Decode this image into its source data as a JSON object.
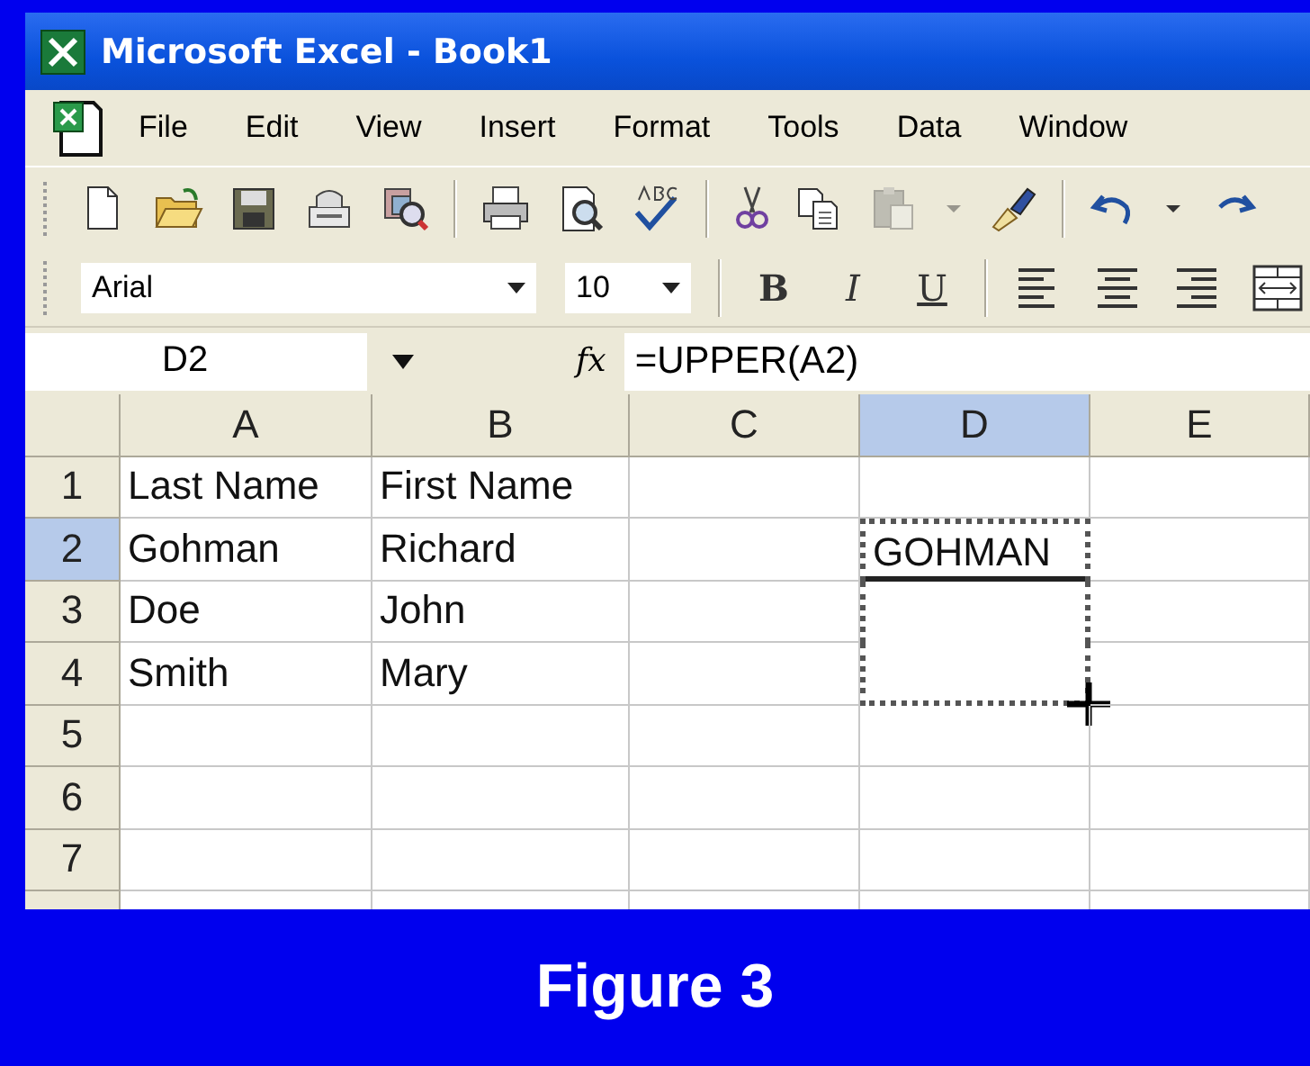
{
  "window": {
    "title": "Microsoft Excel - Book1"
  },
  "menu": [
    "File",
    "Edit",
    "View",
    "Insert",
    "Format",
    "Tools",
    "Data",
    "Window"
  ],
  "standard_toolbar": [
    {
      "kind": "new",
      "disabled": false
    },
    {
      "kind": "open",
      "disabled": false
    },
    {
      "kind": "save",
      "disabled": false
    },
    {
      "kind": "permission",
      "disabled": false
    },
    {
      "kind": "research",
      "disabled": false
    },
    {
      "kind": "separator",
      "disabled": false
    },
    {
      "kind": "print",
      "disabled": false
    },
    {
      "kind": "preview",
      "disabled": false
    },
    {
      "kind": "spelling",
      "disabled": false
    },
    {
      "kind": "separator",
      "disabled": false
    },
    {
      "kind": "cut",
      "disabled": false
    },
    {
      "kind": "copy",
      "disabled": false
    },
    {
      "kind": "paste",
      "disabled": true
    },
    {
      "kind": "dropdown",
      "disabled": true
    },
    {
      "kind": "brush",
      "disabled": false
    },
    {
      "kind": "separator",
      "disabled": false
    },
    {
      "kind": "undo",
      "disabled": false
    },
    {
      "kind": "dropdown",
      "disabled": false
    },
    {
      "kind": "redo",
      "disabled": false
    }
  ],
  "formatting_toolbar": {
    "font": "Arial",
    "size": "10",
    "styles": [
      {
        "kind": "bold",
        "label": "B"
      },
      {
        "kind": "italic",
        "label": "I"
      },
      {
        "kind": "underline",
        "label": "U"
      }
    ],
    "alignments": [
      {
        "kind": "left"
      },
      {
        "kind": "center"
      },
      {
        "kind": "right"
      },
      {
        "kind": "merge"
      }
    ]
  },
  "formula_bar": {
    "name_box": "D2",
    "function_label": "fx",
    "formula": "=UPPER(A2)"
  },
  "sheet": {
    "columns": [
      {
        "label": "A",
        "selected": false
      },
      {
        "label": "B",
        "selected": false
      },
      {
        "label": "C",
        "selected": false
      },
      {
        "label": "D",
        "selected": true
      },
      {
        "label": "E",
        "selected": false
      }
    ],
    "rows": [
      {
        "label": "1",
        "selected": false,
        "cells": [
          {
            "text": "Last Name",
            "selected": false,
            "marquee": false
          },
          {
            "text": "First Name",
            "selected": false,
            "marquee": false
          },
          {
            "selected": false,
            "marquee": false
          },
          {
            "selected": false,
            "marquee": false
          },
          {
            "selected": false,
            "marquee": false
          }
        ]
      },
      {
        "label": "2",
        "selected": true,
        "cells": [
          {
            "text": "Gohman",
            "selected": false,
            "marquee": false
          },
          {
            "text": "Richard",
            "selected": false,
            "marquee": false
          },
          {
            "selected": false,
            "marquee": false
          },
          {
            "text": "GOHMAN",
            "selected": true,
            "marquee": true
          },
          {
            "selected": false,
            "marquee": false
          }
        ]
      },
      {
        "label": "3",
        "selected": false,
        "cells": [
          {
            "text": "Doe",
            "selected": false,
            "marquee": false
          },
          {
            "text": "John",
            "selected": false,
            "marquee": false
          },
          {
            "selected": false,
            "marquee": false
          },
          {
            "selected": false,
            "marquee": true
          },
          {
            "selected": false,
            "marquee": false
          }
        ]
      },
      {
        "label": "4",
        "selected": false,
        "cells": [
          {
            "text": "Smith",
            "selected": false,
            "marquee": false
          },
          {
            "text": "Mary",
            "selected": false,
            "marquee": false
          },
          {
            "selected": false,
            "marquee": false
          },
          {
            "selected": false,
            "marquee": true
          },
          {
            "selected": false,
            "marquee": false
          }
        ]
      },
      {
        "label": "5",
        "selected": false,
        "cells": [
          {
            "selected": false,
            "marquee": false
          },
          {
            "selected": false,
            "marquee": false
          },
          {
            "selected": false,
            "marquee": false
          },
          {
            "selected": false,
            "marquee": false
          },
          {
            "selected": false,
            "marquee": false
          }
        ]
      },
      {
        "label": "6",
        "selected": false,
        "cells": [
          {
            "selected": false,
            "marquee": false
          },
          {
            "selected": false,
            "marquee": false
          },
          {
            "selected": false,
            "marquee": false
          },
          {
            "selected": false,
            "marquee": false
          },
          {
            "selected": false,
            "marquee": false
          }
        ]
      },
      {
        "label": "7",
        "selected": false,
        "cells": [
          {
            "selected": false,
            "marquee": false
          },
          {
            "selected": false,
            "marquee": false
          },
          {
            "selected": false,
            "marquee": false
          },
          {
            "selected": false,
            "marquee": false
          },
          {
            "selected": false,
            "marquee": false
          }
        ]
      }
    ]
  },
  "caption": "Figure 3"
}
